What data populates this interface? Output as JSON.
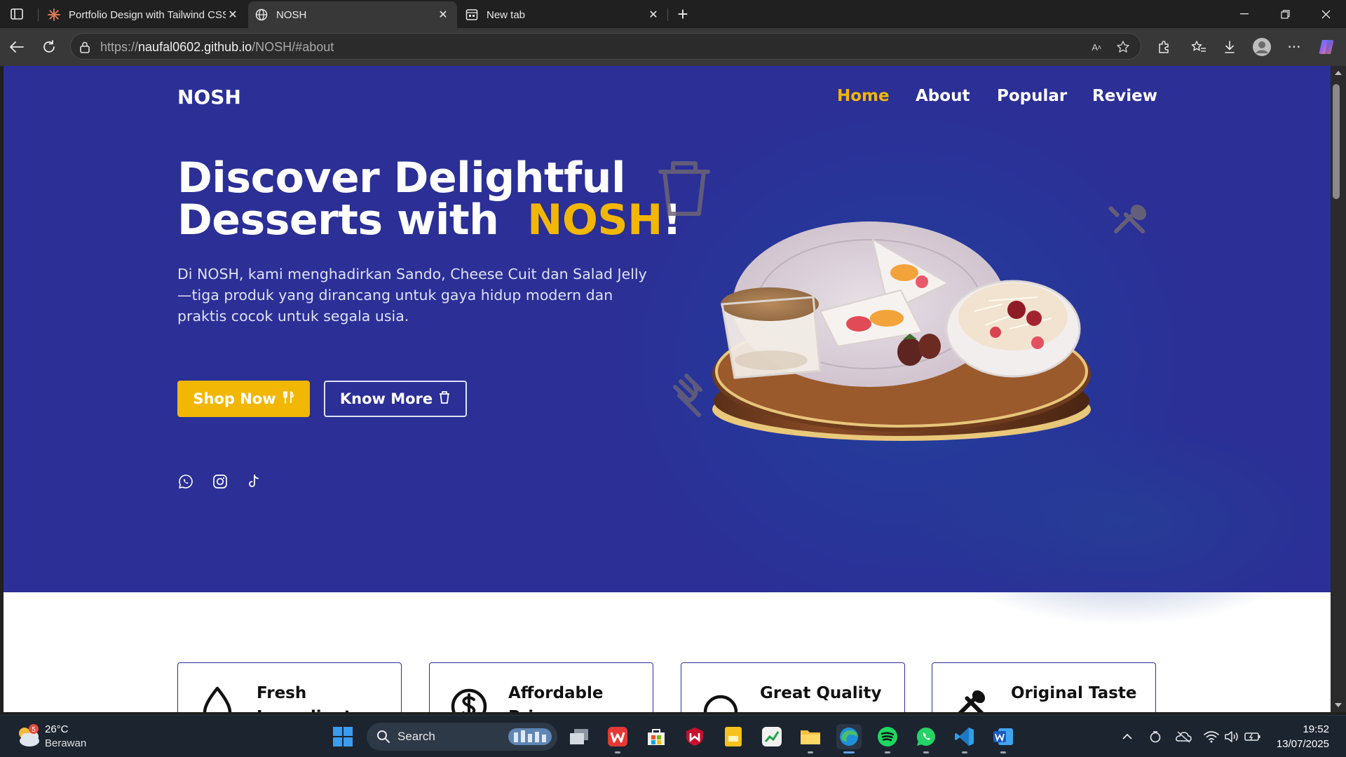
{
  "browser": {
    "tabs": [
      {
        "title": "Portfolio Design with Tailwind CSS",
        "icon": "claude-icon",
        "active": false
      },
      {
        "title": "NOSH",
        "icon": "globe-icon",
        "active": true
      },
      {
        "title": "New tab",
        "icon": "newtab-icon",
        "active": false
      }
    ],
    "url_prefix": "https://",
    "url_host": "naufal0602.github.io",
    "url_path": "/NOSH/#about"
  },
  "site": {
    "brand": "NOSH",
    "nav": [
      {
        "label": "Home",
        "active": true
      },
      {
        "label": "About",
        "active": false
      },
      {
        "label": "Popular",
        "active": false
      },
      {
        "label": "Review",
        "active": false
      }
    ],
    "headline_line1": "Discover Delightful",
    "headline_line2_pre": "Desserts with",
    "headline_accent": "NOSH",
    "headline_suffix": "!",
    "description": "Di NOSH, kami menghadirkan Sando, Cheese Cuit dan Salad Jelly—tiga produk yang dirancang untuk gaya hidup modern dan praktis cocok untuk segala usia.",
    "btn_shop": "Shop Now",
    "btn_know": "Know More",
    "social": [
      "whatsapp-icon",
      "instagram-icon",
      "tiktok-icon"
    ],
    "features": [
      {
        "title": "Fresh Ingredients",
        "icon": "drop-icon"
      },
      {
        "title": "Affordable Price",
        "icon": "dollar-icon"
      },
      {
        "title": "Great Quality",
        "icon": "circle-icon"
      },
      {
        "title": "Original Taste",
        "icon": "utensils-icon"
      }
    ],
    "colors": {
      "hero_bg": "#2b2f96",
      "accent": "#f2b705"
    }
  },
  "taskbar": {
    "weather_temp": "26°C",
    "weather_desc": "Berawan",
    "weather_badge": "5",
    "search_label": "Search",
    "time": "19:52",
    "date": "13/07/2025"
  }
}
